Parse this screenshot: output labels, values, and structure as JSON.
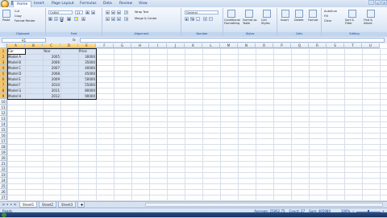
{
  "ribbon_tabs": [
    "Home",
    "Insert",
    "Page Layout",
    "Formulas",
    "Data",
    "Review",
    "View"
  ],
  "active_tab": "Home",
  "clipboard": {
    "paste": "Paste",
    "cut": "Cut",
    "copy": "Copy",
    "format_painter": "Format Painter",
    "label": "Clipboard"
  },
  "font": {
    "name": "Calibri",
    "size": "11",
    "label": "Font"
  },
  "alignment": {
    "wrap": "Wrap Text",
    "merge": "Merge & Center",
    "label": "Alignment"
  },
  "number": {
    "format": "General",
    "currency": "$",
    "percent": "%",
    "comma": ",",
    "label": "Number"
  },
  "styles": {
    "conditional": "Conditional Formatting",
    "table": "Format as Table",
    "cell": "Cell Styles",
    "label": "Styles"
  },
  "cells": {
    "insert": "Insert",
    "delete": "Delete",
    "format": "Format",
    "label": "Cells"
  },
  "editing": {
    "autosum": "AutoSum",
    "fill": "Fill",
    "clear": "Clear",
    "sort": "Sort & Filter",
    "find": "Find & Select",
    "label": "Editing"
  },
  "formula_bar": {
    "name_box": "A1",
    "fx": "fx",
    "value": ""
  },
  "columns": [
    "A",
    "B",
    "C",
    "D",
    "E",
    "F",
    "G",
    "H",
    "I",
    "J",
    "K",
    "L",
    "M",
    "N",
    "O",
    "P",
    "Q",
    "R",
    "S",
    "T",
    "U"
  ],
  "rows": [
    "1",
    "2",
    "3",
    "4",
    "5",
    "6",
    "7",
    "8",
    "9",
    "10",
    "11",
    "12",
    "13",
    "14",
    "15",
    "16",
    "17",
    "18",
    "19",
    "20",
    "21",
    "22",
    "23",
    "24",
    "25",
    "26",
    "27"
  ],
  "table": {
    "headers": [
      "Car",
      "Year",
      "Price"
    ],
    "data": [
      [
        "Model A",
        "2005",
        "30000"
      ],
      [
        "Model B",
        "2006",
        "35000"
      ],
      [
        "Model C",
        "2007",
        "40000"
      ],
      [
        "Model D",
        "2008",
        "45000"
      ],
      [
        "Model E",
        "2009",
        "50000"
      ],
      [
        "Model F",
        "2010",
        "55000"
      ],
      [
        "Model G",
        "2011",
        "80000"
      ],
      [
        "Model H",
        "2012",
        "90000"
      ]
    ]
  },
  "sheets": [
    "Sheet1",
    "Sheet2",
    "Sheet3"
  ],
  "active_sheet": "Sheet1",
  "status": {
    "mode": "Ready",
    "average": "Average: 25862.75",
    "count": "Count: 27",
    "sum": "Sum: 465980",
    "zoom": "100%"
  },
  "colors": {
    "accent": "#15428b",
    "selection": "#f6c66a",
    "ribbon": "#dde8f6"
  }
}
